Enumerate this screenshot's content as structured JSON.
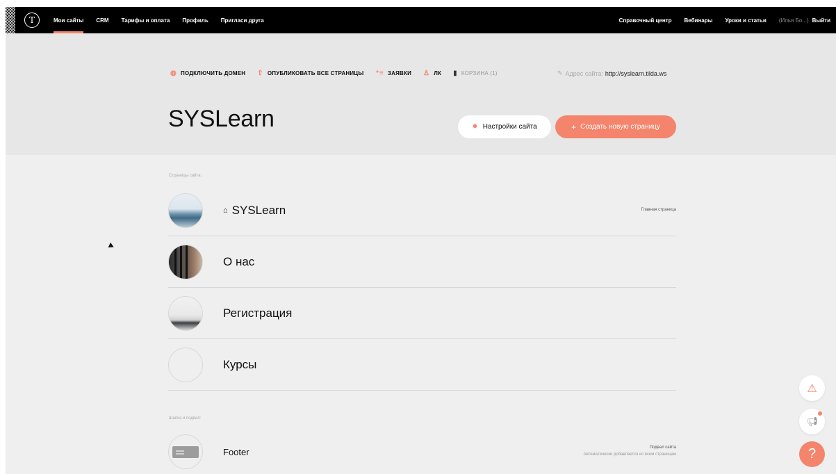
{
  "nav": {
    "logo": "T",
    "left": [
      "Мои сайты",
      "CRM",
      "Тарифы и оплата",
      "Профиль",
      "Пригласи друга"
    ],
    "right": [
      "Справочный центр",
      "Вебинары",
      "Уроки и статьи"
    ],
    "user": "(Илья Бо...)",
    "logout": "Выйти"
  },
  "toolbar": {
    "connect_domain": "ПОДКЛЮЧИТЬ ДОМЕН",
    "publish_all": "ОПУБЛИКОВАТЬ ВСЕ СТРАНИЦЫ",
    "leads": "ЗАЯВКИ",
    "lk": "ЛК",
    "trash": "КОРЗИНА (1)",
    "address_label": "Адрес сайта:",
    "address_url": "http://syslearn.tilda.ws"
  },
  "site": {
    "title": "SYSLearn",
    "settings_button": "Настройки сайта",
    "create_button": "Создать новую страницу"
  },
  "sections": {
    "pages_label": "Страницы сайта:",
    "header_footer_label": "Шапка и подвал:"
  },
  "pages": [
    {
      "title": "SYSLearn",
      "note": "Главная страница",
      "home": true
    },
    {
      "title": "О нас",
      "note": ""
    },
    {
      "title": "Регистрация",
      "note": ""
    },
    {
      "title": "Курсы",
      "note": ""
    }
  ],
  "footer": {
    "title": "Footer",
    "note": "Подвал сайта",
    "sub": "Автоматически добавляется ко всем страницам"
  },
  "icons": {
    "globe": "globe-icon",
    "upload": "upload-icon",
    "leads": "list-icon",
    "user": "user-icon",
    "trash": "trash-icon",
    "edit": "edit-icon",
    "gear": "gear-icon",
    "plus": "plus-icon",
    "home": "home-icon",
    "warning": "warning-icon",
    "megaphone": "megaphone-icon",
    "help": "help-icon"
  },
  "colors": {
    "accent": "#f4846b",
    "topbar": "#000000",
    "header_bg": "#e7e7e7",
    "page_bg": "#efefef"
  }
}
